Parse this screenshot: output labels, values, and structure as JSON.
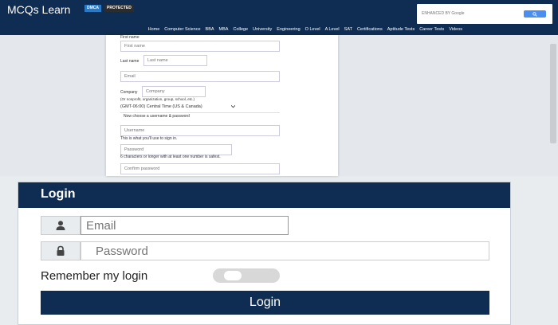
{
  "header": {
    "logo": "MCQs Learn",
    "badge_dmca": "DMCA",
    "badge_protected": "PROTECTED",
    "search_placeholder": "ENHANCED BY Google",
    "nav": [
      "Home",
      "Computer Science",
      "BBA",
      "MBA",
      "College",
      "University",
      "Engineering",
      "O Level",
      "A Level",
      "SAT",
      "Certifications",
      "Aptitude Tests",
      "Career Tests",
      "Videos"
    ]
  },
  "registration": {
    "first_name_label": "First name",
    "first_name_placeholder": "First name",
    "last_name_label": "Last name",
    "last_name_placeholder": "Last name",
    "email_placeholder": "Email",
    "company_label": "Company",
    "company_placeholder": "Company",
    "company_hint": "(Or nonprofit, organization, group, school, etc.)",
    "timezone_value": "(GMT-06:00) Central Time (US & Canada)",
    "credentials_heading": "Now choose a username & password",
    "username_placeholder": "Username",
    "username_hint": "This is what you'll use to sign in.",
    "password_placeholder": "Password",
    "password_hint": "6 characters or longer with at least one number is safest.",
    "confirm_password_placeholder": "Confirm password"
  },
  "login": {
    "title": "Login",
    "email_placeholder": "Email",
    "password_placeholder": "Password",
    "remember_label": "Remember my login",
    "remember_checked": false,
    "submit_label": "Login"
  },
  "colors": {
    "brand_navy": "#0f2d52",
    "search_blue": "#4c8ef0"
  }
}
